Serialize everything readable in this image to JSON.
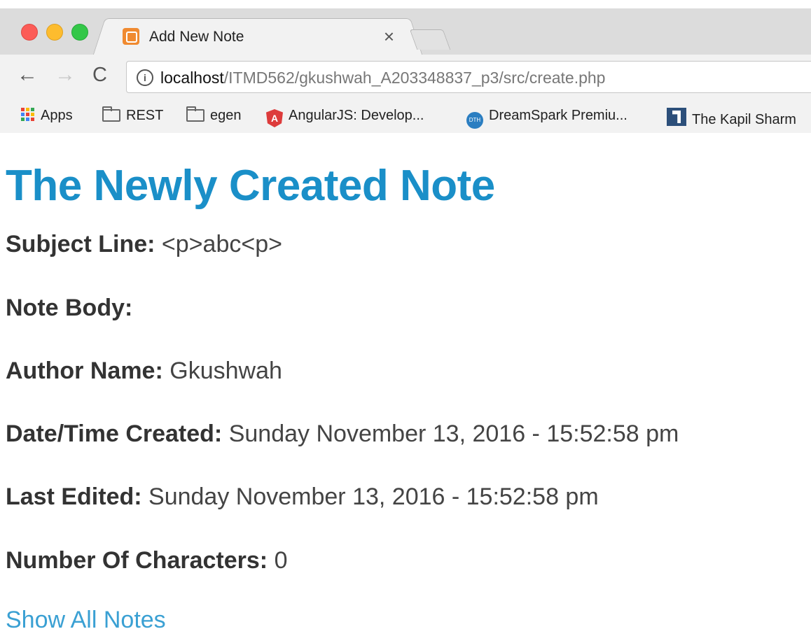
{
  "browser": {
    "tab_title": "Add New Note",
    "tab_close": "×",
    "nav": {
      "back": "←",
      "forward": "→",
      "reload": "C"
    },
    "url": {
      "host": "localhost",
      "path": "/ITMD562/gkushwah_A203348837_p3/src/create.php"
    },
    "bookmarks": [
      {
        "label": "Apps",
        "icon": "apps-grid-icon"
      },
      {
        "label": "REST",
        "icon": "folder-icon"
      },
      {
        "label": "egen",
        "icon": "folder-icon"
      },
      {
        "label": "AngularJS: Develop...",
        "icon": "angularjs-icon"
      },
      {
        "label": "DreamSpark Premiu...",
        "icon": "dreamspark-icon"
      },
      {
        "label": "The Kapil Sharm",
        "icon": "kapil-sharma-icon"
      }
    ]
  },
  "page": {
    "title": "The Newly Created Note",
    "fields": [
      {
        "label": "Subject Line:",
        "value": "<p>abc<p>"
      },
      {
        "label": "Note Body:",
        "value": ""
      },
      {
        "label": "Author Name:",
        "value": "Gkushwah"
      },
      {
        "label": "Date/Time Created:",
        "value": "Sunday November 13, 2016 - 15:52:58 pm"
      },
      {
        "label": "Last Edited:",
        "value": "Sunday November 13, 2016 - 15:52:58 pm"
      },
      {
        "label": "Number Of Characters:",
        "value": "0"
      }
    ],
    "show_all_link": "Show All Notes"
  }
}
